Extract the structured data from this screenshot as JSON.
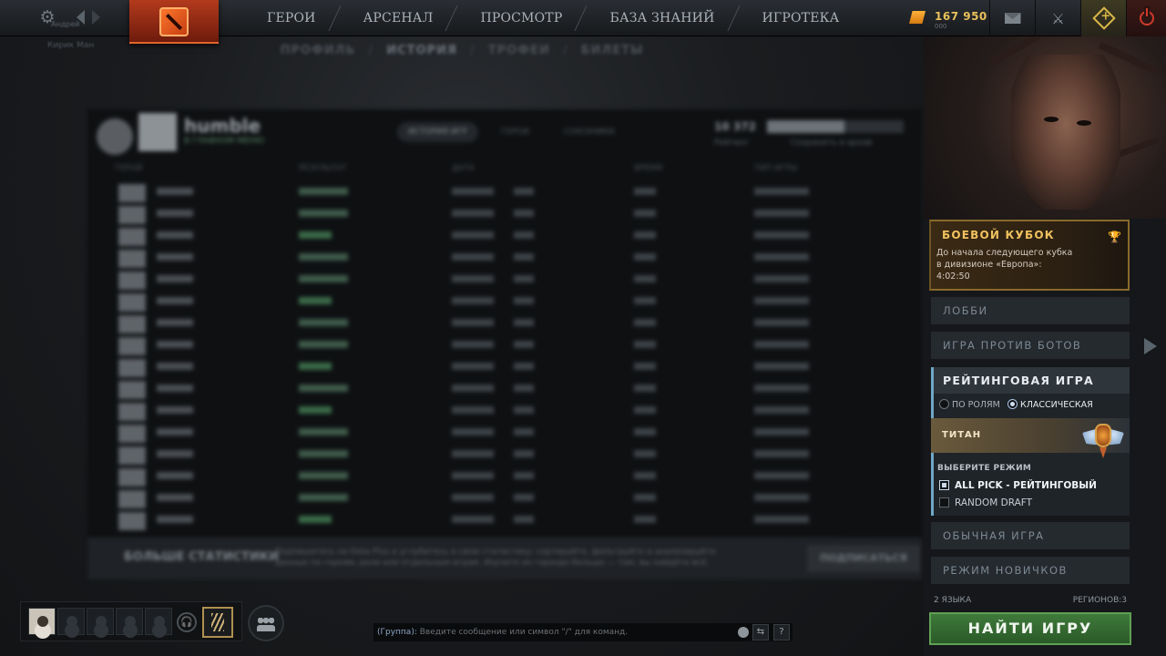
{
  "topbar": {
    "player_name_hint": "Андрей",
    "player_name_hint2": "Кирик Ман",
    "nav": [
      "ГЕРОИ",
      "АРСЕНАЛ",
      "ПРОСМОТР",
      "БАЗА ЗНАНИЙ",
      "ИГРОТЕКА"
    ],
    "shards_value": "167 950",
    "shards_sub": "000"
  },
  "subnav": [
    "ПРОФИЛЬ",
    "ИСТОРИЯ",
    "ТРОФЕИ",
    "БИЛЕТЫ"
  ],
  "profile": {
    "name": "humble",
    "status": "В ГЛАВНОМ МЕНЮ",
    "tabs": [
      "ИСТОРИЯ ИГР",
      "ГЕРОИ",
      "СОЮЗНИКИ"
    ],
    "stat_value": "10 372",
    "stat_label": "Рейтинг",
    "progress_label": "Сохранить в архив",
    "columns": [
      "ГЕРОЙ",
      "РЕЗУЛЬТАТ",
      "ДАТА",
      "ВРЕМЯ",
      "ТИП ИГРЫ"
    ]
  },
  "matches": [
    {
      "hero": "Lion",
      "result": "Поражение",
      "win": false
    },
    {
      "hero": "Magnus",
      "result": "Поражение",
      "win": false
    },
    {
      "hero": "Windrunner",
      "result": "Победа",
      "win": true
    },
    {
      "hero": "Spirit Breaker",
      "result": "Поражение",
      "win": false
    },
    {
      "hero": "Rubick",
      "result": "Поражение",
      "win": false
    },
    {
      "hero": "Magnus",
      "result": "Победа",
      "win": true
    },
    {
      "hero": "Spirit Breaker",
      "result": "Поражение",
      "win": false
    },
    {
      "hero": "Muerta",
      "result": "Поражение",
      "win": false
    },
    {
      "hero": "Lion",
      "result": "Победа",
      "win": true
    },
    {
      "hero": "Magnus",
      "result": "Поражение",
      "win": false
    },
    {
      "hero": "Muerta",
      "result": "Победа",
      "win": true
    },
    {
      "hero": "Magnus",
      "result": "Поражение",
      "win": false
    },
    {
      "hero": "Lion",
      "result": "Поражение",
      "win": false
    },
    {
      "hero": "Magnus",
      "result": "Поражение",
      "win": false
    },
    {
      "hero": "Gyrocopter",
      "result": "Поражение",
      "win": false
    },
    {
      "hero": "Magnus",
      "result": "Победа",
      "win": true
    }
  ],
  "more_stats": {
    "title": "БОЛЬШЕ СТАТИСТИКИ",
    "text": "Подпишитесь на Dota Plus и углубитесь в свою статистику: сортируйте, фильтруйте и анализируйте данные по героям, роли или отдельным играм. Изучите их гораздо больше — там, вы найдёте всё.",
    "button": "ПОДПИСАТЬСЯ"
  },
  "chat": {
    "channel": "(Группа):",
    "placeholder": "Введите сообщение или символ \"/\" для команд.",
    "help": "?"
  },
  "battle_cup": {
    "title": "БОЕВОЙ КУБОК",
    "line1": "До начала следующего кубка",
    "line2": "в дивизионе «Европа»:",
    "timer": "4:02:50"
  },
  "modes": {
    "lobby": "ЛОББИ",
    "bots": "ИГРА ПРОТИВ БОТОВ",
    "ranked": "РЕЙТИНГОВАЯ ИГРА",
    "normal": "ОБЫЧНАЯ ИГРА",
    "newbie": "РЕЖИМ НОВИЧКОВ"
  },
  "ranked": {
    "radio_roles": "ПО РОЛЯМ",
    "radio_classic": "КЛАССИЧЕСКАЯ",
    "rank": "ТИТАН",
    "choose_mode": "ВЫБЕРИТЕ РЕЖИМ",
    "opt_allpick": "ALL PICK - РЕЙТИНГОВЫЙ",
    "opt_random": "RANDOM DRAFT"
  },
  "footer": {
    "languages": "2 ЯЗЫКА",
    "regions": "РЕГИОНОВ:3",
    "find_game": "НАЙТИ ИГРУ"
  }
}
